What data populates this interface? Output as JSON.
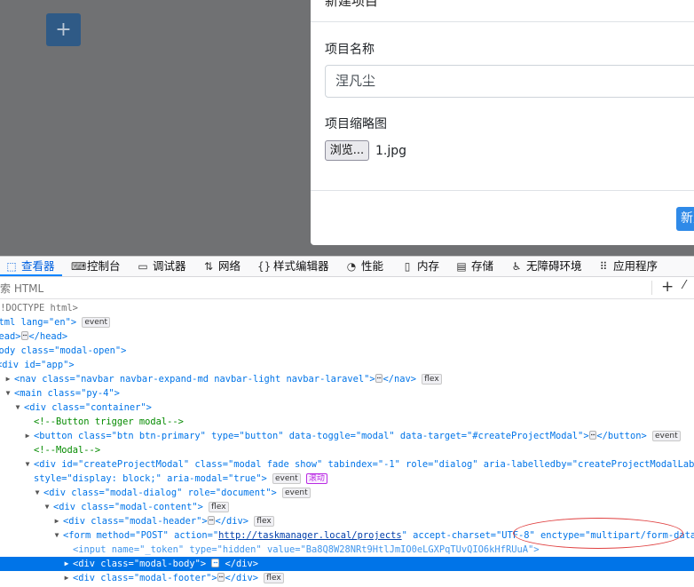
{
  "page": {
    "add_button": "+",
    "modal": {
      "title": "新建项目",
      "name_label": "项目名称",
      "name_value": "涅凡尘",
      "thumb_label": "项目缩略图",
      "browse_label": "浏览...",
      "file_name": "1.jpg",
      "submit_label": "新建"
    }
  },
  "devtools": {
    "tabs": [
      {
        "label": "查看器",
        "icon": "inspector-icon"
      },
      {
        "label": "控制台",
        "icon": "console-icon"
      },
      {
        "label": "调试器",
        "icon": "debugger-icon"
      },
      {
        "label": "网络",
        "icon": "network-icon"
      },
      {
        "label": "样式编辑器",
        "icon": "style-editor-icon"
      },
      {
        "label": "性能",
        "icon": "performance-icon"
      },
      {
        "label": "内存",
        "icon": "memory-icon"
      },
      {
        "label": "存储",
        "icon": "storage-icon"
      },
      {
        "label": "无障碍环境",
        "icon": "accessibility-icon"
      },
      {
        "label": "应用程序",
        "icon": "application-icon"
      }
    ],
    "search_placeholder": "搜索 HTML",
    "tree": {
      "doctype": "<!DOCTYPE html>",
      "html_open": "<html lang=\"en\">",
      "head": "<head>",
      "head_close": "</head>",
      "body": "<body class=\"modal-open\">",
      "app": "<div id=\"app\">",
      "nav_open": "<nav class=\"navbar navbar-expand-md navbar-light navbar-laravel\">",
      "nav_close": "</nav>",
      "main": "<main class=\"py-4\">",
      "container": "<div class=\"container\">",
      "comment_trigger": "<!--Button trigger modal-->",
      "button_open": "<button class=\"btn btn-primary\" type=\"button\" data-toggle=\"modal\" data-target=\"#createProjectModal\">",
      "button_close": "</button>",
      "comment_modal": "<!--Modal-->",
      "modal_div_1": "<div id=\"createProjectModal\" class=\"modal fade show\" tabindex=\"-1\" role=\"dialog\" aria-labelledby=\"createProjectModalLabel\"",
      "modal_div_2": "style=\"display: block;\" aria-modal=\"true\">",
      "dialog": "<div class=\"modal-dialog\" role=\"document\">",
      "content": "<div class=\"modal-content\">",
      "header": "<div class=\"modal-header\">",
      "div_close": "</div>",
      "form_pre": "<form method=\"POST\" action=\"",
      "form_action": "http://taskmanager.local/projects",
      "form_post": "\" accept-charset=\"UTF-8\" enctype=\"multipart/form-data\">",
      "input": "<input name=\"_token\" type=\"hidden\" value=\"Ba8Q8W28NRt9HtlJmIO0eLGXPqTUvQIO6kHfRUuA\">",
      "body_div": "<div class=\"modal-body\">",
      "footer_div": "<div class=\"modal-footer\">"
    },
    "badges": {
      "event": "event",
      "flex": "flex",
      "scroll": "滚动",
      "ellipsis": "⋯"
    }
  },
  "colors": {
    "backdrop": "#707173",
    "primary": "#2f5a86",
    "selection": "#0074e8",
    "tag": "#0074e8",
    "attr": "#dd00a9",
    "value": "#003eaa",
    "comment": "#058b00",
    "annotation": "#e04040"
  }
}
